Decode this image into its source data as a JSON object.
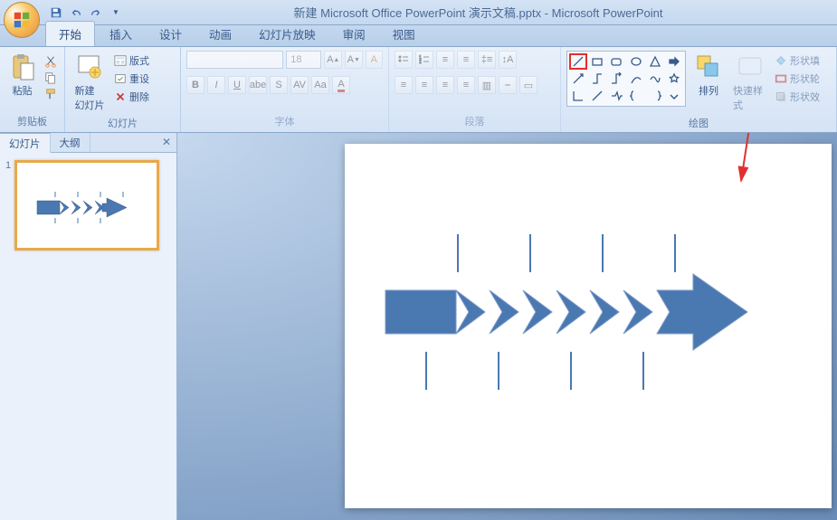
{
  "title": "新建 Microsoft Office PowerPoint 演示文稿.pptx - Microsoft PowerPoint",
  "tabs": [
    "开始",
    "插入",
    "设计",
    "动画",
    "幻灯片放映",
    "审阅",
    "视图"
  ],
  "activeTab": 0,
  "ribbon": {
    "clipboard": {
      "label": "剪贴板",
      "paste": "粘贴"
    },
    "slides": {
      "label": "幻灯片",
      "newSlide": "新建\n幻灯片",
      "layout": "版式",
      "reset": "重设",
      "delete": "删除"
    },
    "font": {
      "label": "字体",
      "size": "18"
    },
    "paragraph": {
      "label": "段落"
    },
    "drawing": {
      "label": "绘图",
      "arrange": "排列",
      "quickStyles": "快速样式",
      "shapeFill": "形状填",
      "shapeOutline": "形状轮",
      "shapeEffects": "形状效"
    }
  },
  "panetabs": {
    "slides": "幻灯片",
    "outline": "大纲"
  },
  "thumbNumber": "1",
  "arrowColor": "#4a78b0"
}
